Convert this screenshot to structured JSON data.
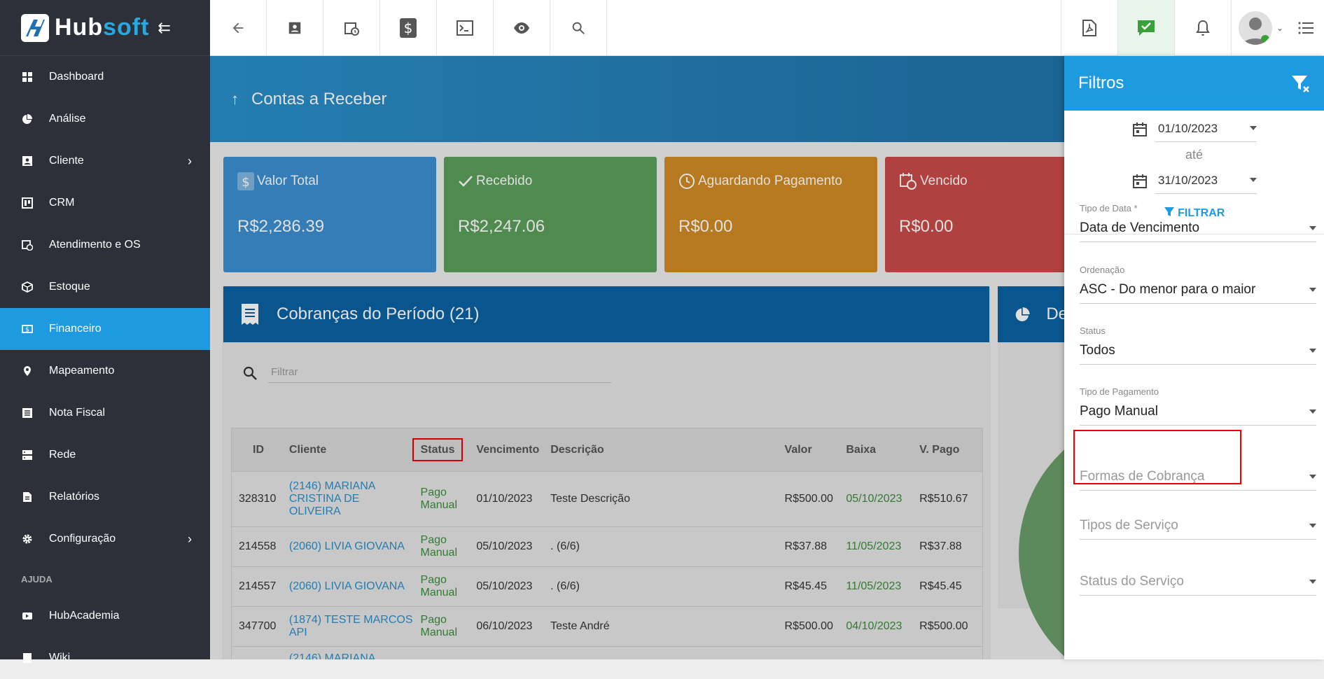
{
  "app": {
    "brand_a": "Hub",
    "brand_b": "soft"
  },
  "sidebar": {
    "items": [
      {
        "label": "Dashboard",
        "icon": "dashboard-icon",
        "chevron": false,
        "active": false
      },
      {
        "label": "Análise",
        "icon": "pie-chart-icon",
        "chevron": false,
        "active": false
      },
      {
        "label": "Cliente",
        "icon": "contact-card-icon",
        "chevron": true,
        "active": false
      },
      {
        "label": "CRM",
        "icon": "kanban-icon",
        "chevron": false,
        "active": false
      },
      {
        "label": "Atendimento e OS",
        "icon": "calendar-clock-icon",
        "chevron": false,
        "active": false
      },
      {
        "label": "Estoque",
        "icon": "box-icon",
        "chevron": false,
        "active": false
      },
      {
        "label": "Financeiro",
        "icon": "money-icon",
        "chevron": false,
        "active": true
      },
      {
        "label": "Mapeamento",
        "icon": "map-pin-icon",
        "chevron": false,
        "active": false
      },
      {
        "label": "Nota Fiscal",
        "icon": "list-doc-icon",
        "chevron": false,
        "active": false
      },
      {
        "label": "Rede",
        "icon": "server-icon",
        "chevron": false,
        "active": false
      },
      {
        "label": "Relatórios",
        "icon": "report-icon",
        "chevron": false,
        "active": false
      },
      {
        "label": "Configuração",
        "icon": "gear-icon",
        "chevron": true,
        "active": false
      }
    ],
    "section_help": "AJUDA",
    "help_items": [
      {
        "label": "HubAcademia",
        "icon": "video-icon"
      },
      {
        "label": "Wiki",
        "icon": "book-icon"
      }
    ]
  },
  "banner": {
    "title": "Contas a Receber"
  },
  "cards": [
    {
      "title": "Valor Total",
      "value": "R$2,286.39",
      "color": "#3d8fd1"
    },
    {
      "title": "Recebido",
      "value": "R$2,247.06",
      "color": "#5a9e5a"
    },
    {
      "title": "Aguardando Pagamento",
      "value": "R$0.00",
      "color": "#d08a24"
    },
    {
      "title": "Vencido",
      "value": "R$0.00",
      "color": "#c94b48"
    }
  ],
  "panel": {
    "title": "Cobranças do Período (21)",
    "search_placeholder": "Filtrar",
    "right_title": "De"
  },
  "table": {
    "headers": {
      "id": "ID",
      "cliente": "Cliente",
      "status": "Status",
      "vencimento": "Vencimento",
      "descricao": "Descrição",
      "valor": "Valor",
      "baixa": "Baixa",
      "vpago": "V. Pago"
    },
    "rows": [
      {
        "id": "328310",
        "cliente": "(2146) MARIANA CRISTINA DE OLIVEIRA",
        "status": "Pago Manual",
        "vencimento": "01/10/2023",
        "descricao": "Teste Descrição",
        "valor": "R$500.00",
        "baixa": "05/10/2023",
        "vpago": "R$510.67"
      },
      {
        "id": "214558",
        "cliente": "(2060) LIVIA GIOVANA",
        "status": "Pago Manual",
        "vencimento": "05/10/2023",
        "descricao": ". (6/6)",
        "valor": "R$37.88",
        "baixa": "11/05/2023",
        "vpago": "R$37.88"
      },
      {
        "id": "214557",
        "cliente": "(2060) LIVIA GIOVANA",
        "status": "Pago Manual",
        "vencimento": "05/10/2023",
        "descricao": ". (6/6)",
        "valor": "R$45.45",
        "baixa": "11/05/2023",
        "vpago": "R$45.45"
      },
      {
        "id": "347700",
        "cliente": "(1874) TESTE MARCOS API",
        "status": "Pago Manual",
        "vencimento": "06/10/2023",
        "descricao": "Teste André",
        "valor": "R$500.00",
        "baixa": "04/10/2023",
        "vpago": "R$500.00"
      },
      {
        "id": "",
        "cliente": "(2146) MARIANA",
        "status": "",
        "vencimento": "",
        "descricao": "",
        "valor": "",
        "baixa": "",
        "vpago": ""
      }
    ]
  },
  "filters": {
    "title": "Filtros",
    "date_from": "01/10/2023",
    "date_sep": "até",
    "date_to": "31/10/2023",
    "apply": "FILTRAR",
    "fields": [
      {
        "label": "Tipo de Data *",
        "value": "Data de Vencimento",
        "placeholder": false
      },
      {
        "label": "Ordenação",
        "value": "ASC - Do menor para o maior",
        "placeholder": false
      },
      {
        "label": "Status",
        "value": "Todos",
        "placeholder": false
      },
      {
        "label": "Tipo de Pagamento",
        "value": "Pago Manual",
        "placeholder": false
      },
      {
        "label": "",
        "value": "Formas de Cobrança",
        "placeholder": true
      },
      {
        "label": "",
        "value": "Tipos de Serviço",
        "placeholder": true
      },
      {
        "label": "",
        "value": "Status do Serviço",
        "placeholder": true
      }
    ]
  }
}
